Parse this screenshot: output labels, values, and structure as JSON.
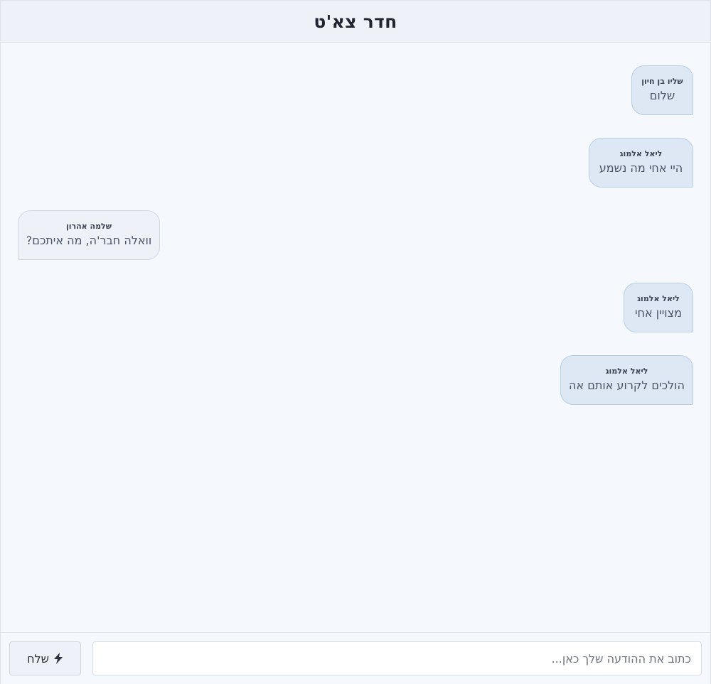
{
  "header": {
    "title": "חדר צא'ט"
  },
  "messages": [
    {
      "sender": "שליו בן חיון",
      "text": "שלום",
      "side": "mine"
    },
    {
      "sender": "ליאל אלמוג",
      "text": "היי אחי מה נשמע",
      "side": "mine"
    },
    {
      "sender": "שלמה אהרון",
      "text": "וואלה חבר'ה, מה איתכם?",
      "side": "other"
    },
    {
      "sender": "ליאל אלמוג",
      "text": "מצויין אחי",
      "side": "mine"
    },
    {
      "sender": "ליאל אלמוג",
      "text": "הולכים לקרוע אותם אה",
      "side": "mine"
    }
  ],
  "composer": {
    "input_value": "",
    "input_placeholder": "כתוב את ההודעה שלך כאן...",
    "send_label": "שלח",
    "send_icon": "bolt-icon"
  },
  "colors": {
    "mine_bubble": "#dee8f4",
    "other_bubble": "#eef1f7",
    "background": "#f5f8fd",
    "header": "#eef2f8"
  }
}
